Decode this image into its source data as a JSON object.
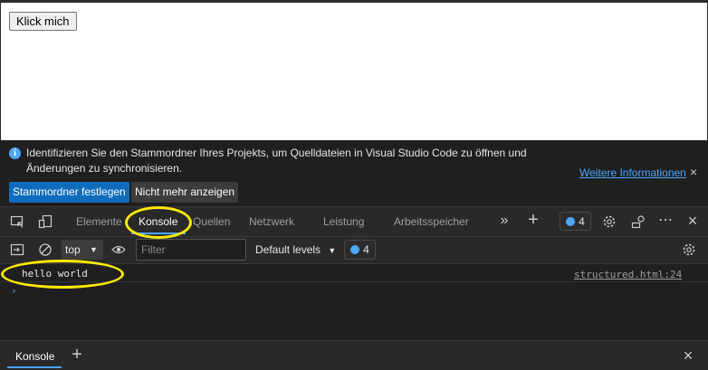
{
  "page": {
    "button_label": "Klick mich"
  },
  "infobar": {
    "icon": "info-icon",
    "text": "Identifizieren Sie den Stammordner Ihres Projekts, um Quelldateien in Visual Studio Code zu öffnen und Änderungen zu synchronisieren.",
    "link": "Weitere Informationen",
    "close": "×",
    "primary_button": "Stammordner festlegen",
    "secondary_button": "Nicht mehr anzeigen"
  },
  "toolbar": {
    "tabs": [
      "Elemente",
      "Konsole",
      "Quellen",
      "Netzwerk",
      "Leistung",
      "Arbeitsspeicher"
    ],
    "active_tab": "Konsole",
    "more_tabs": "»",
    "add_tab": "+",
    "issues_count": "4"
  },
  "console_toolbar": {
    "context": "top",
    "filter_placeholder": "Filter",
    "levels": "Default levels",
    "issues_count": "4"
  },
  "console": {
    "messages": [
      {
        "text": "hello world",
        "source": "structured.html:24"
      }
    ],
    "prompt": "›"
  },
  "drawer": {
    "tab": "Konsole",
    "add": "+",
    "close": "×"
  },
  "colors": {
    "accent": "#4da6ff",
    "primary_button": "#0f6cbd",
    "annotation": "#ffea00"
  }
}
